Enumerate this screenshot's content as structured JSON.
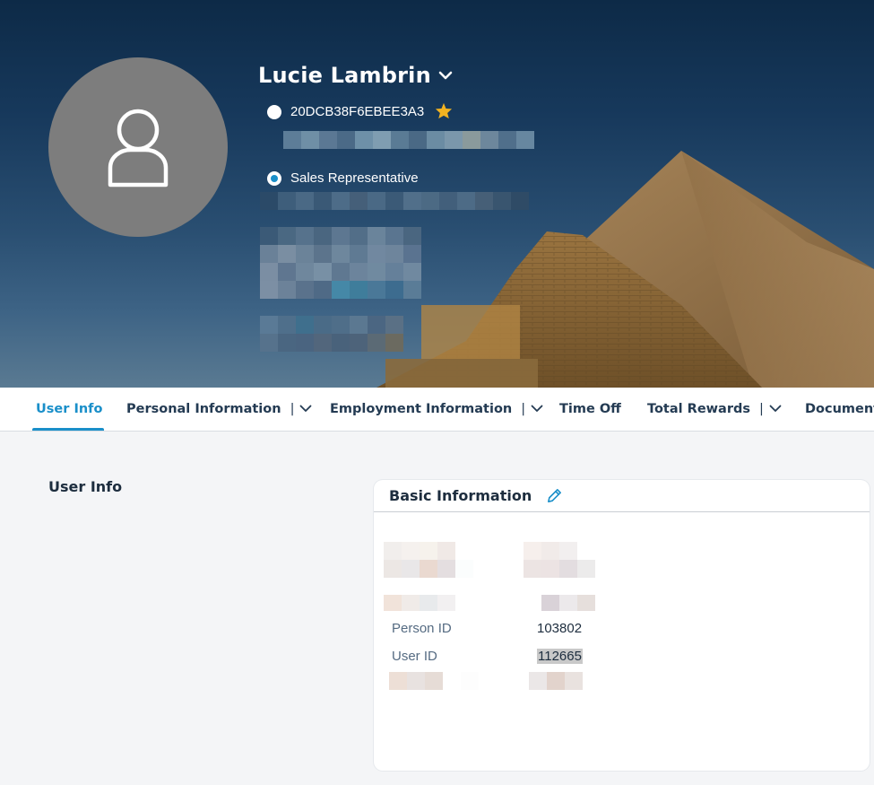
{
  "profile": {
    "name": "Lucie Lambrin",
    "id_code": "20DCB38F6EBEE3A3",
    "job_title": "Sales Representative"
  },
  "tabs": [
    {
      "label": "User Info",
      "active": true,
      "has_menu": false
    },
    {
      "label": "Personal Information",
      "active": false,
      "has_menu": true
    },
    {
      "label": "Employment Information",
      "active": false,
      "has_menu": true
    },
    {
      "label": "Time Off",
      "active": false,
      "has_menu": false
    },
    {
      "label": "Total Rewards",
      "active": false,
      "has_menu": true
    },
    {
      "label": "Documents",
      "active": false,
      "has_menu": false
    }
  ],
  "tab_separator": "|",
  "section": {
    "title": "User Info"
  },
  "card": {
    "title": "Basic Information",
    "fields": [
      {
        "label": "Person ID",
        "value": "103802"
      },
      {
        "label": "User ID",
        "value": "112665"
      }
    ]
  },
  "colors": {
    "accent": "#1a8fc9",
    "star": "#f2b321",
    "avatar_bg": "#7d7d7d",
    "banner_top": "#0d2a47"
  },
  "icons": {
    "avatar": "person-outline-icon",
    "name_menu": "chevron-down-icon",
    "favorite": "star-icon",
    "edit": "pencil-icon"
  }
}
